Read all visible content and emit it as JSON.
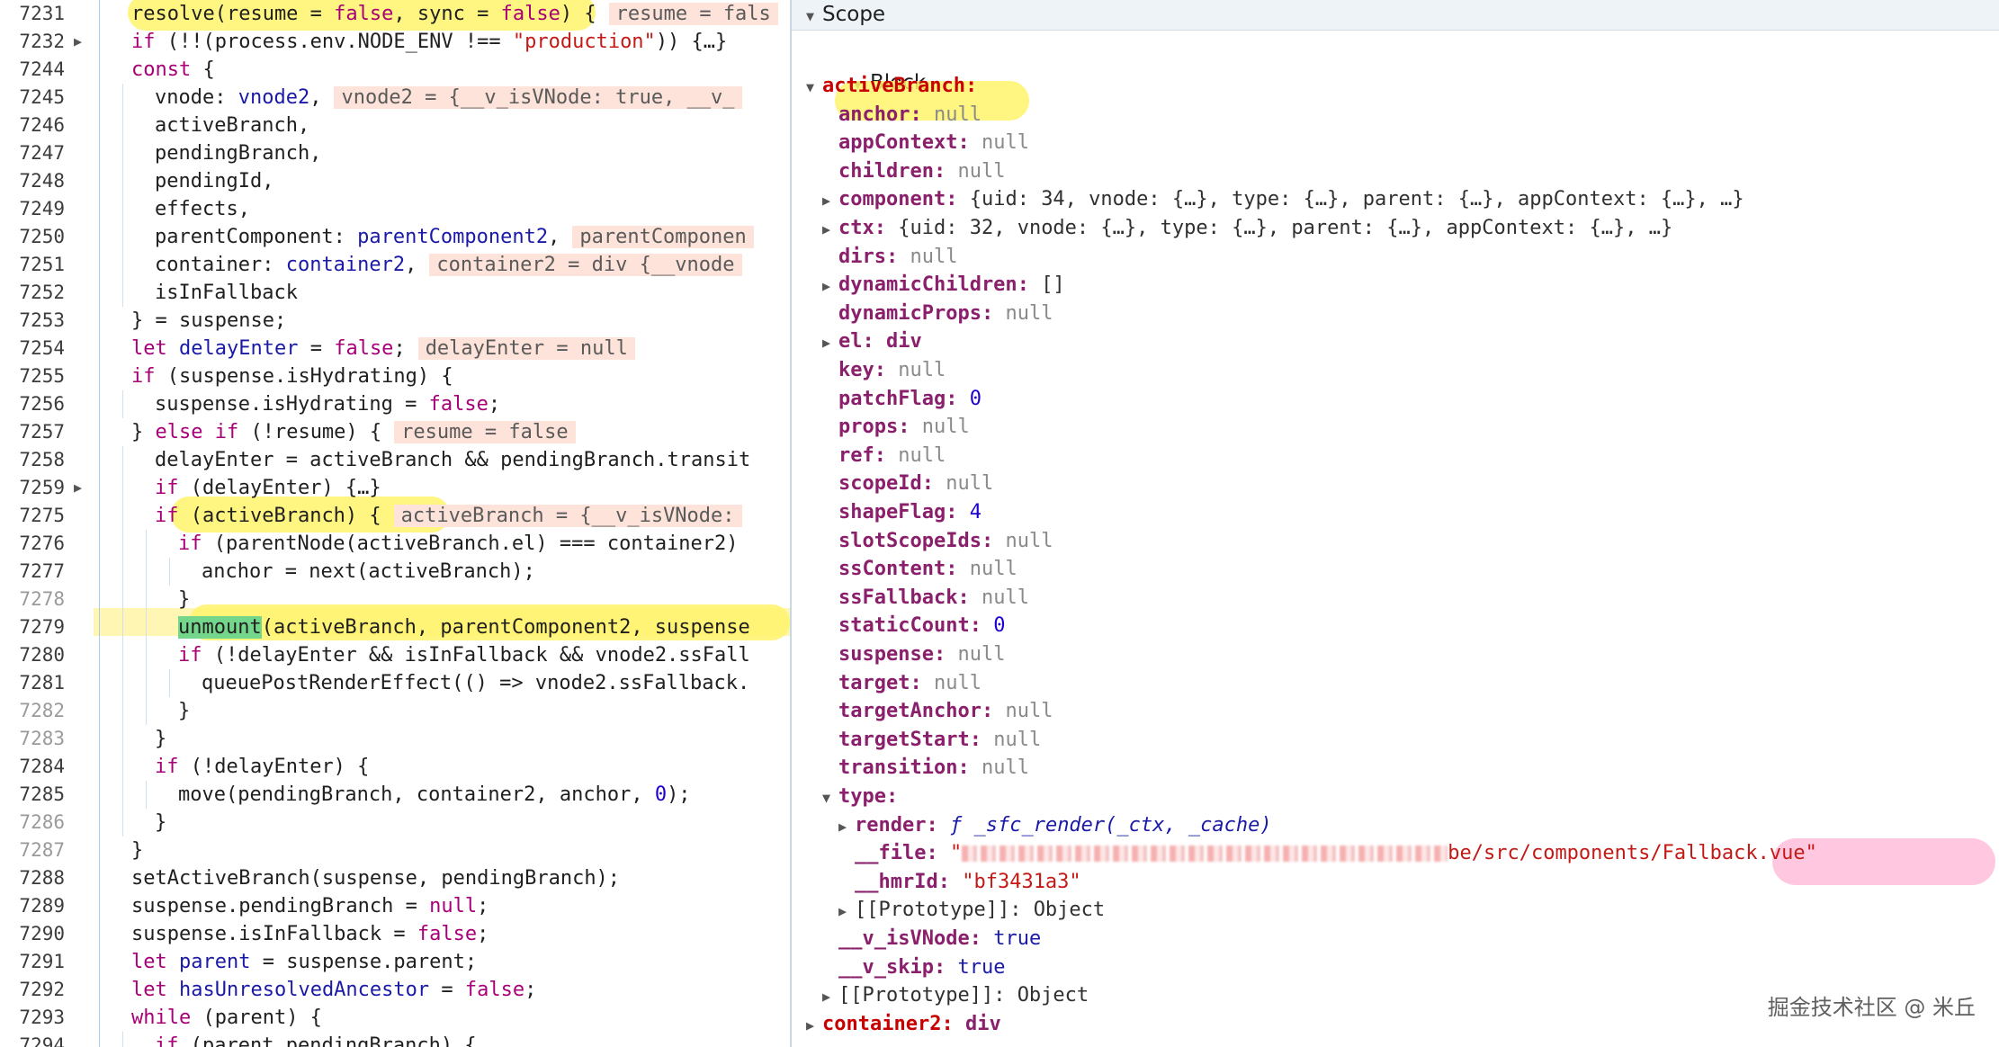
{
  "source": {
    "lines": [
      {
        "num": "7231",
        "indent": 1,
        "fold": false,
        "dim": false,
        "html": "resolve(resume = <span class='kw'>false</span>, sync = <span class='kw'>false</span>) {",
        "inline": "resume = fals"
      },
      {
        "num": "7232",
        "indent": 1,
        "fold": true,
        "dim": false,
        "html": "<span class='kw'>if</span> (!!(process.env.NODE_ENV !== <span class='st'>\"production\"</span>)) {…}",
        "inline": ""
      },
      {
        "num": "7244",
        "indent": 1,
        "fold": false,
        "dim": false,
        "html": "<span class='kw'>const</span> {",
        "inline": ""
      },
      {
        "num": "7245",
        "indent": 2,
        "fold": false,
        "dim": false,
        "html": "vnode: <span class='bl'>vnode2</span>,",
        "inline": "vnode2 = {__v_isVNode: true, __v_"
      },
      {
        "num": "7246",
        "indent": 2,
        "fold": false,
        "dim": false,
        "html": "activeBranch,",
        "inline": ""
      },
      {
        "num": "7247",
        "indent": 2,
        "fold": false,
        "dim": false,
        "html": "pendingBranch,",
        "inline": ""
      },
      {
        "num": "7248",
        "indent": 2,
        "fold": false,
        "dim": false,
        "html": "pendingId,",
        "inline": ""
      },
      {
        "num": "7249",
        "indent": 2,
        "fold": false,
        "dim": false,
        "html": "effects,",
        "inline": ""
      },
      {
        "num": "7250",
        "indent": 2,
        "fold": false,
        "dim": false,
        "html": "parentComponent: <span class='bl'>parentComponent2</span>,",
        "inline": "parentComponen"
      },
      {
        "num": "7251",
        "indent": 2,
        "fold": false,
        "dim": false,
        "html": "container: <span class='bl'>container2</span>,",
        "inline": "container2 = div {__vnode"
      },
      {
        "num": "7252",
        "indent": 2,
        "fold": false,
        "dim": false,
        "html": "isInFallback",
        "inline": ""
      },
      {
        "num": "7253",
        "indent": 1,
        "fold": false,
        "dim": false,
        "html": "} = suspense;",
        "inline": ""
      },
      {
        "num": "7254",
        "indent": 1,
        "fold": false,
        "dim": false,
        "html": "<span class='kw'>let</span> <span class='bl'>delayEnter</span> = <span class='kw'>false</span>;",
        "inline": "delayEnter = null"
      },
      {
        "num": "7255",
        "indent": 1,
        "fold": false,
        "dim": false,
        "html": "<span class='kw'>if</span> (suspense.isHydrating) {",
        "inline": ""
      },
      {
        "num": "7256",
        "indent": 2,
        "fold": false,
        "dim": false,
        "html": "suspense.isHydrating = <span class='kw'>false</span>;",
        "inline": ""
      },
      {
        "num": "7257",
        "indent": 1,
        "fold": false,
        "dim": false,
        "html": "} <span class='kw'>else if</span> (!resume) {",
        "inline": "resume = false"
      },
      {
        "num": "7258",
        "indent": 2,
        "fold": false,
        "dim": false,
        "html": "delayEnter = activeBranch &amp;&amp; pendingBranch.transit",
        "inline": ""
      },
      {
        "num": "7259",
        "indent": 2,
        "fold": true,
        "dim": false,
        "html": "<span class='kw'>if</span> (delayEnter) {…}",
        "inline": ""
      },
      {
        "num": "7275",
        "indent": 2,
        "fold": false,
        "dim": false,
        "html": "<span class='kw'>if</span> (activeBranch) {",
        "inline": "activeBranch = {__v_isVNode:"
      },
      {
        "num": "7276",
        "indent": 3,
        "fold": false,
        "dim": false,
        "html": "<span class='kw'>if</span> (parentNode(activeBranch.el) === container2)",
        "inline": ""
      },
      {
        "num": "7277",
        "indent": 4,
        "fold": false,
        "dim": false,
        "html": "anchor = next(activeBranch);",
        "inline": ""
      },
      {
        "num": "7278",
        "indent": 3,
        "fold": false,
        "dim": true,
        "html": "}",
        "inline": ""
      },
      {
        "num": "7279",
        "indent": 3,
        "fold": false,
        "dim": false,
        "html": "<span class='hl-green'>unmount</span>(activeBranch, parentComponent2, suspense",
        "inline": ""
      },
      {
        "num": "7280",
        "indent": 3,
        "fold": false,
        "dim": false,
        "html": "<span class='kw'>if</span> (!delayEnter &amp;&amp; isInFallback &amp;&amp; vnode2.ssFall",
        "inline": ""
      },
      {
        "num": "7281",
        "indent": 4,
        "fold": false,
        "dim": false,
        "html": "queuePostRenderEffect(() =&gt; vnode2.ssFallback.",
        "inline": ""
      },
      {
        "num": "7282",
        "indent": 3,
        "fold": false,
        "dim": true,
        "html": "}",
        "inline": ""
      },
      {
        "num": "7283",
        "indent": 2,
        "fold": false,
        "dim": true,
        "html": "}",
        "inline": ""
      },
      {
        "num": "7284",
        "indent": 2,
        "fold": false,
        "dim": false,
        "html": "<span class='kw'>if</span> (!delayEnter) {",
        "inline": ""
      },
      {
        "num": "7285",
        "indent": 3,
        "fold": false,
        "dim": false,
        "html": "move(pendingBranch, container2, anchor, <span class='nm'>0</span>);",
        "inline": ""
      },
      {
        "num": "7286",
        "indent": 2,
        "fold": false,
        "dim": true,
        "html": "}",
        "inline": ""
      },
      {
        "num": "7287",
        "indent": 1,
        "fold": false,
        "dim": true,
        "html": "}",
        "inline": ""
      },
      {
        "num": "7288",
        "indent": 1,
        "fold": false,
        "dim": false,
        "html": "setActiveBranch(suspense, pendingBranch);",
        "inline": ""
      },
      {
        "num": "7289",
        "indent": 1,
        "fold": false,
        "dim": false,
        "html": "suspense.pendingBranch = <span class='kw'>null</span>;",
        "inline": ""
      },
      {
        "num": "7290",
        "indent": 1,
        "fold": false,
        "dim": false,
        "html": "suspense.isInFallback = <span class='kw'>false</span>;",
        "inline": ""
      },
      {
        "num": "7291",
        "indent": 1,
        "fold": false,
        "dim": false,
        "html": "<span class='kw'>let</span> <span class='bl'>parent</span> = suspense.parent;",
        "inline": ""
      },
      {
        "num": "7292",
        "indent": 1,
        "fold": false,
        "dim": false,
        "html": "<span class='kw'>let</span> <span class='bl'>hasUnresolvedAncestor</span> = <span class='kw'>false</span>;",
        "inline": ""
      },
      {
        "num": "7293",
        "indent": 1,
        "fold": false,
        "dim": false,
        "html": "<span class='kw'>while</span> (parent) {",
        "inline": ""
      },
      {
        "num": "7294",
        "indent": 2,
        "fold": false,
        "dim": false,
        "html": "<span class='kw'>if</span> (parent.pendingBranch) {",
        "inline": ""
      }
    ]
  },
  "scope": {
    "title": "Scope",
    "section": "Block",
    "rows": [
      {
        "level": 1,
        "arrow": "open",
        "key": "activeBranch",
        "top": true,
        "value": "",
        "vclass": ""
      },
      {
        "level": 2,
        "arrow": "",
        "key": "anchor",
        "value": "null",
        "vclass": "null"
      },
      {
        "level": 2,
        "arrow": "",
        "key": "appContext",
        "value": "null",
        "vclass": "null"
      },
      {
        "level": 2,
        "arrow": "",
        "key": "children",
        "value": "null",
        "vclass": "null"
      },
      {
        "level": 2,
        "arrow": "closed",
        "key": "component",
        "value": "{uid: 34, vnode: {…}, type: {…}, parent: {…}, appContext: {…}, …}",
        "vclass": "obj"
      },
      {
        "level": 2,
        "arrow": "closed",
        "key": "ctx",
        "value": "{uid: 32, vnode: {…}, type: {…}, parent: {…}, appContext: {…}, …}",
        "vclass": "obj"
      },
      {
        "level": 2,
        "arrow": "",
        "key": "dirs",
        "value": "null",
        "vclass": "null"
      },
      {
        "level": 2,
        "arrow": "closed",
        "key": "dynamicChildren",
        "value": "[]",
        "vclass": "obj"
      },
      {
        "level": 2,
        "arrow": "",
        "key": "dynamicProps",
        "value": "null",
        "vclass": "null"
      },
      {
        "level": 2,
        "arrow": "closed",
        "key": "el",
        "value": "div",
        "vclass": "key"
      },
      {
        "level": 2,
        "arrow": "",
        "key": "key",
        "value": "null",
        "vclass": "null"
      },
      {
        "level": 2,
        "arrow": "",
        "key": "patchFlag",
        "value": "0",
        "vclass": "num"
      },
      {
        "level": 2,
        "arrow": "",
        "key": "props",
        "value": "null",
        "vclass": "null"
      },
      {
        "level": 2,
        "arrow": "",
        "key": "ref",
        "value": "null",
        "vclass": "null"
      },
      {
        "level": 2,
        "arrow": "",
        "key": "scopeId",
        "value": "null",
        "vclass": "null"
      },
      {
        "level": 2,
        "arrow": "",
        "key": "shapeFlag",
        "value": "4",
        "vclass": "num"
      },
      {
        "level": 2,
        "arrow": "",
        "key": "slotScopeIds",
        "value": "null",
        "vclass": "null"
      },
      {
        "level": 2,
        "arrow": "",
        "key": "ssContent",
        "value": "null",
        "vclass": "null"
      },
      {
        "level": 2,
        "arrow": "",
        "key": "ssFallback",
        "value": "null",
        "vclass": "null"
      },
      {
        "level": 2,
        "arrow": "",
        "key": "staticCount",
        "value": "0",
        "vclass": "num"
      },
      {
        "level": 2,
        "arrow": "",
        "key": "suspense",
        "value": "null",
        "vclass": "null"
      },
      {
        "level": 2,
        "arrow": "",
        "key": "target",
        "value": "null",
        "vclass": "null"
      },
      {
        "level": 2,
        "arrow": "",
        "key": "targetAnchor",
        "value": "null",
        "vclass": "null"
      },
      {
        "level": 2,
        "arrow": "",
        "key": "targetStart",
        "value": "null",
        "vclass": "null"
      },
      {
        "level": 2,
        "arrow": "",
        "key": "transition",
        "value": "null",
        "vclass": "null"
      },
      {
        "level": 2,
        "arrow": "open",
        "key": "type",
        "value": "",
        "vclass": ""
      },
      {
        "level": 3,
        "arrow": "closed",
        "key": "render",
        "value": "ƒ _sfc_render(_ctx, _cache)",
        "vclass": "fn"
      },
      {
        "level": 3,
        "arrow": "",
        "key": "__file",
        "value": "\"",
        "tail": "be/src/components/Fallback.vue\"",
        "blur": true,
        "vclass": "strv"
      },
      {
        "level": 3,
        "arrow": "",
        "key": "__hmrId",
        "value": "\"bf3431a3\"",
        "vclass": "strv"
      },
      {
        "level": 3,
        "arrow": "closed",
        "key": "[[Prototype]]",
        "plain": true,
        "value": "Object",
        "vclass": "meta"
      },
      {
        "level": 2,
        "arrow": "",
        "key": "__v_isVNode",
        "value": "true",
        "vclass": "boolv"
      },
      {
        "level": 2,
        "arrow": "",
        "key": "__v_skip",
        "value": "true",
        "vclass": "boolv"
      },
      {
        "level": 2,
        "arrow": "closed",
        "key": "[[Prototype]]",
        "plain": true,
        "value": "Object",
        "vclass": "meta"
      },
      {
        "level": 1,
        "arrow": "closed",
        "key": "container2",
        "top": true,
        "value": "div",
        "vclass": "key"
      }
    ]
  },
  "watermark": "掘金技术社区 @ 米丘"
}
